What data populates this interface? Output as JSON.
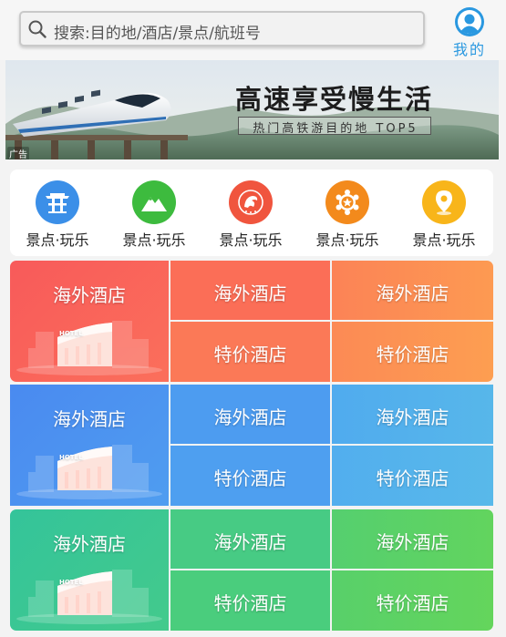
{
  "header": {
    "search_placeholder": "搜索:目的地/酒店/景点/航班号",
    "me_label": "我的"
  },
  "banner": {
    "title": "高速享受慢生活",
    "subtitle": "热门高铁游目的地 TOP5",
    "ad_tag": "广告"
  },
  "categories": [
    {
      "label": "景点·玩乐",
      "icon": "pagoda-icon",
      "color": "#3b8fe8"
    },
    {
      "label": "景点·玩乐",
      "icon": "mountain-icon",
      "color": "#3dbb3e"
    },
    {
      "label": "景点·玩乐",
      "icon": "dragon-badge-icon",
      "color": "#f0553e"
    },
    {
      "label": "景点·玩乐",
      "icon": "flower-badge-icon",
      "color": "#f38a1c"
    },
    {
      "label": "景点·玩乐",
      "icon": "map-pin-icon",
      "color": "#f8b51a"
    }
  ],
  "hotel_sections": [
    {
      "theme": "red",
      "main": "海外酒店",
      "cells": [
        "海外酒店",
        "海外酒店",
        "特价酒店",
        "特价酒店"
      ],
      "colors": {
        "main": "#fa5d56",
        "cell": "#fb7459",
        "cell_right": "#fc9552"
      }
    },
    {
      "theme": "blue",
      "main": "海外酒店",
      "cells": [
        "海外酒店",
        "海外酒店",
        "特价酒店",
        "特价酒店"
      ],
      "colors": {
        "main": "#4b8ff0",
        "cell": "#4d9ef0",
        "cell_right": "#55b3ea"
      }
    },
    {
      "theme": "green",
      "main": "海外酒店",
      "cells": [
        "海外酒店",
        "海外酒店",
        "特价酒店",
        "特价酒店"
      ],
      "colors": {
        "main": "#37c694",
        "cell": "#47cc86",
        "cell_right": "#5cd165"
      }
    }
  ]
}
